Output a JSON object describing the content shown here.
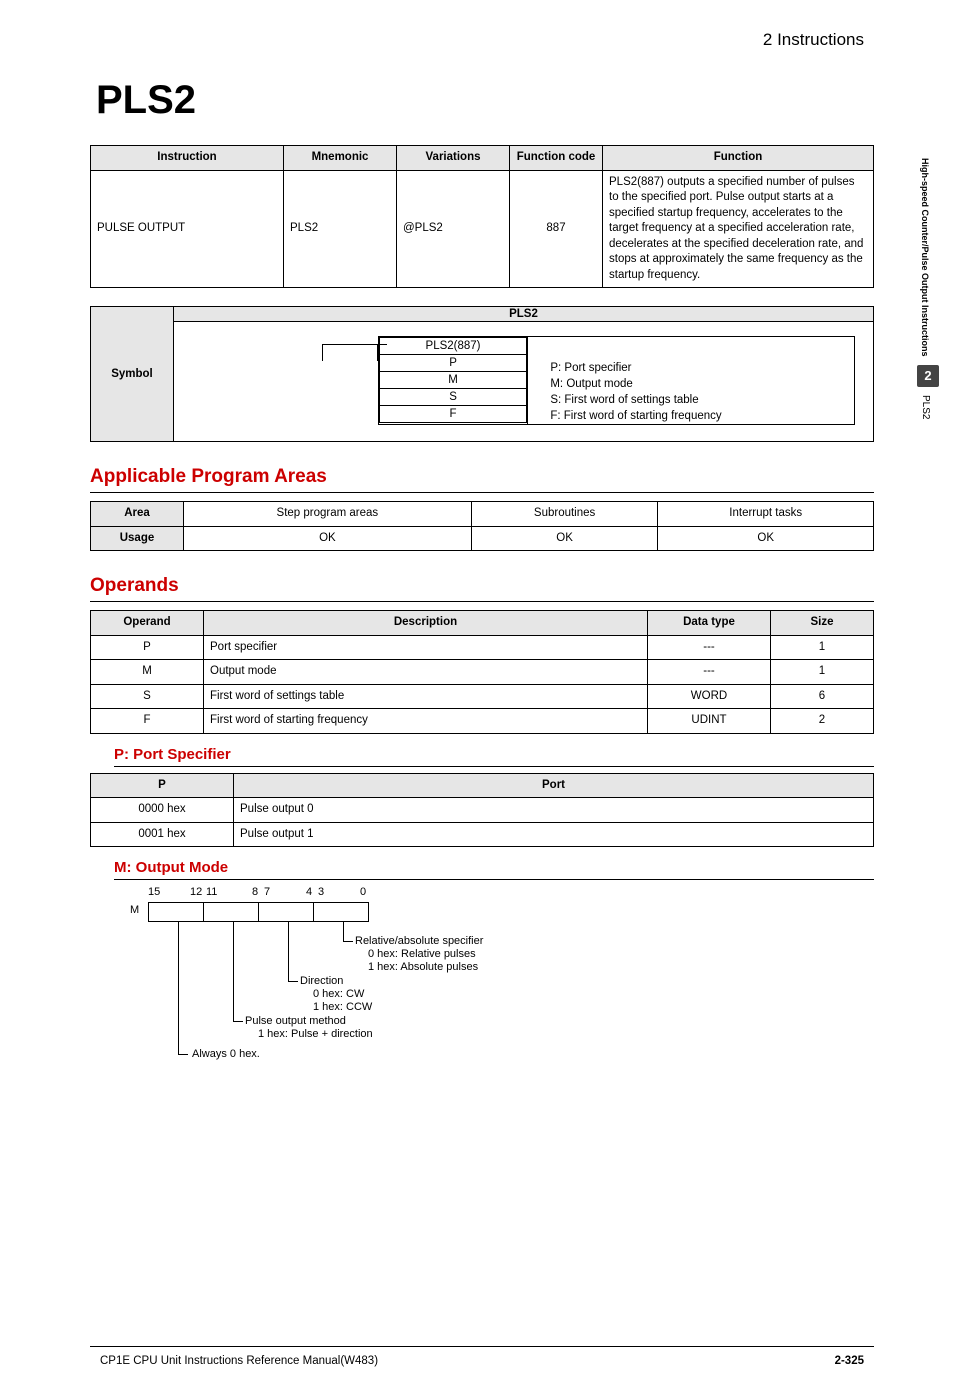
{
  "header": "2   Instructions",
  "title": "PLS2",
  "t1": {
    "h": [
      "Instruction",
      "Mnemonic",
      "Variations",
      "Function code",
      "Function"
    ],
    "r": [
      "PULSE OUTPUT",
      "PLS2",
      "@PLS2",
      "887",
      "PLS2(887) outputs a specified number of pulses to the specified port. Pulse output starts at a specified startup frequency, accelerates to the target frequency at a specified acceleration rate, decelerates at the specified deceleration rate, and stops at approximately the same frequency as the startup frequency."
    ]
  },
  "sym": {
    "side": "Symbol",
    "title": "PLS2",
    "box": [
      "PLS2(887)",
      "P",
      "M",
      "S",
      "F"
    ],
    "labels": [
      "P:  Port specifier",
      "M: Output mode",
      "S:  First word of settings table",
      "F:  First word of starting frequency"
    ]
  },
  "apa": {
    "h": "Applicable Program Areas",
    "th": [
      "Area",
      "Step program areas",
      "Subroutines",
      "Interrupt tasks"
    ],
    "tr": [
      "Usage",
      "OK",
      "OK",
      "OK"
    ]
  },
  "ops": {
    "h": "Operands",
    "th": [
      "Operand",
      "Description",
      "Data type",
      "Size"
    ],
    "r": [
      [
        "P",
        "Port specifier",
        "---",
        "1"
      ],
      [
        "M",
        "Output mode",
        "---",
        "1"
      ],
      [
        "S",
        "First word of settings table",
        "WORD",
        "6"
      ],
      [
        "F",
        "First word of starting frequency",
        "UDINT",
        "2"
      ]
    ]
  },
  "port": {
    "h": "P: Port Specifier",
    "th": [
      "P",
      "Port"
    ],
    "r": [
      [
        "0000 hex",
        "Pulse output 0"
      ],
      [
        "0001 hex",
        "Pulse output 1"
      ]
    ]
  },
  "mode": {
    "h": "M: Output Mode",
    "bits": [
      "15",
      "12",
      "11",
      "8",
      "7",
      "4",
      "3",
      "0"
    ],
    "mlabel": "M",
    "a": {
      "t": "Relative/absolute specifier",
      "l1": "0 hex: Relative pulses",
      "l2": "1 hex: Absolute pulses"
    },
    "b": {
      "t": "Direction",
      "l1": "0 hex: CW",
      "l2": "1 hex: CCW"
    },
    "c": {
      "t": "Pulse output method",
      "l1": "1 hex: Pulse + direction"
    },
    "d": {
      "t": "Always 0 hex."
    }
  },
  "side": {
    "v1": "High-speed Counter/Pulse Output Instructions",
    "num": "2",
    "v2": "PLS2"
  },
  "footer": {
    "l": "CP1E CPU Unit Instructions Reference Manual(W483)",
    "r": "2-325"
  }
}
